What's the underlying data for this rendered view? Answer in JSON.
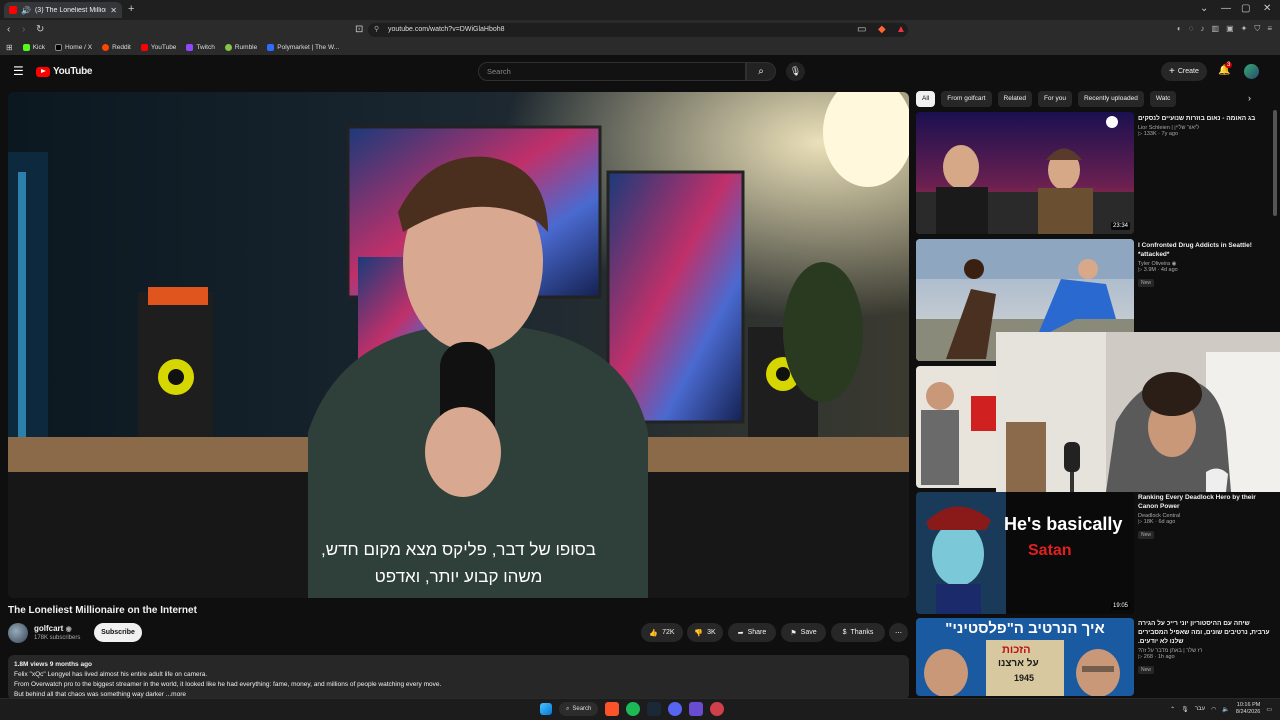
{
  "browser": {
    "tab_title": "(3) The Loneliest Millionaire ...",
    "url": "youtube.com/watch?v=DWiGlaHboh8",
    "bookmarks": [
      "Kick",
      "Home / X",
      "Reddit",
      "YouTube",
      "Twitch",
      "Rumble",
      "Polymarket | The W..."
    ]
  },
  "youtube": {
    "logo_text": "YouTube",
    "search_placeholder": "Search",
    "create_label": "Create",
    "notifications_count": "3"
  },
  "video": {
    "subtitle_line1": "בסופו של דבר, פליקס מצא מקום חדש,",
    "subtitle_line2": "משהו קבוע יותר, ואדפט",
    "title": "The Loneliest Millionaire on the Internet",
    "channel_name": "golfcart",
    "subscribers": "178K subscribers",
    "subscribe_label": "Subscribe",
    "likes": "72K",
    "dislikes": "3K",
    "share_label": "Share",
    "save_label": "Save",
    "thanks_label": "Thanks",
    "stats": "1.8M views  9 months ago",
    "desc_line1": "Felix \"xQc\" Lengyel has lived almost his entire adult life on camera.",
    "desc_line2": "From Overwatch pro to the biggest streamer in the world, it looked like he had everything: fame, money, and millions of people watching every move.",
    "desc_line3": "But behind all that chaos was something way darker ...more"
  },
  "sidebar": {
    "chips": [
      "All",
      "From golfcart",
      "Related",
      "For you",
      "Recently uploaded",
      "Watc"
    ],
    "videos": [
      {
        "title": "בג האומה - נאום בוזרות שנועיים לנסקים",
        "channel": "Lior Schleien | ליאור שליין",
        "views": "133K",
        "age": "7y ago",
        "duration": "23:34",
        "badge": ""
      },
      {
        "title": "I Confronted Drug Addicts in Seattle! *attacked*",
        "channel": "Tyler Oliveira",
        "views": "3.9M",
        "age": "4d ago",
        "duration": "",
        "badge": "New"
      },
      {
        "title": "Ranking Every Deadlock Hero by their Canon Power",
        "channel": "Deadlock Central",
        "views": "18K",
        "age": "6d ago",
        "duration": "19:05",
        "badge": "New"
      },
      {
        "title": "שיחה עם ההיסטוריון יוני רייכ על הגירה ערבית, נרטיבים שונים, ומה שאפיל המסבירים שלנו לא יודעים.",
        "channel": "רז שלר | באתן מדבר על זה?",
        "views": "268",
        "age": "1h ago",
        "duration": "",
        "badge": "New"
      }
    ],
    "thumb3_line1": "He's basically",
    "thumb3_line2": "Satan",
    "thumb4_line1": "איך הנרטיב ה\"פלסטיני\"",
    "thumb4_line2": "הזכות",
    "thumb4_line3": "על ארצנו",
    "thumb4_year": "1945"
  },
  "taskbar": {
    "search_label": "Search",
    "time": "10:16 PM",
    "date": "8/24/2026",
    "lang": "עבר"
  }
}
